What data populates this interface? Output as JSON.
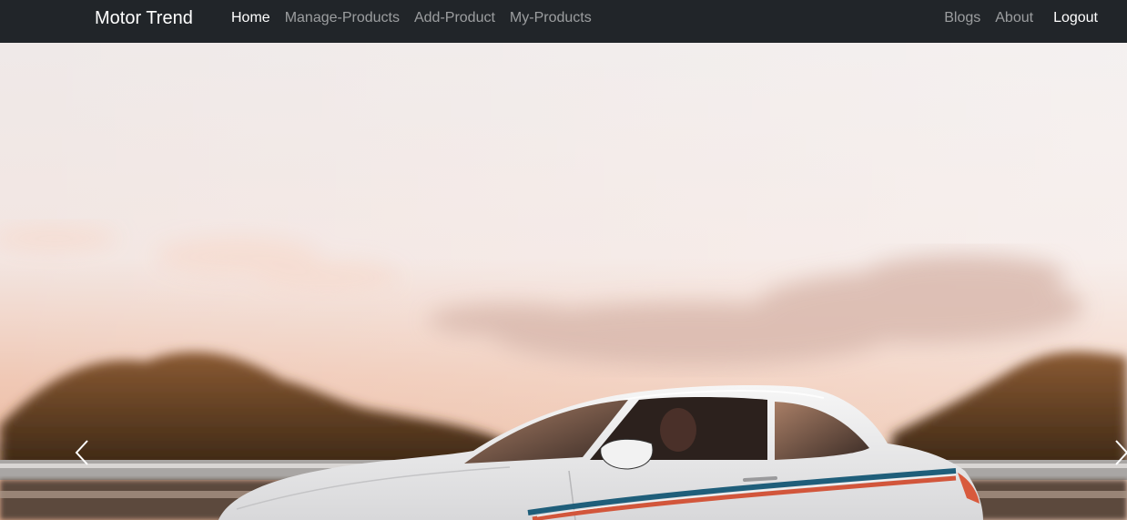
{
  "brand": "Motor Trend",
  "nav": {
    "home": "Home",
    "manage_products": "Manage-Products",
    "add_product": "Add-Product",
    "my_products": "My-Products",
    "blogs": "Blogs",
    "about": "About",
    "logout": "Logout"
  },
  "carousel": {
    "slide_description": "White sports coupe driving along a highway at sunset",
    "prev_icon": "chevron-left-icon",
    "next_icon": "chevron-right-icon"
  },
  "colors": {
    "navbar_bg": "#212529",
    "nav_active": "#ffffff",
    "nav_muted": "#8c8f93"
  }
}
